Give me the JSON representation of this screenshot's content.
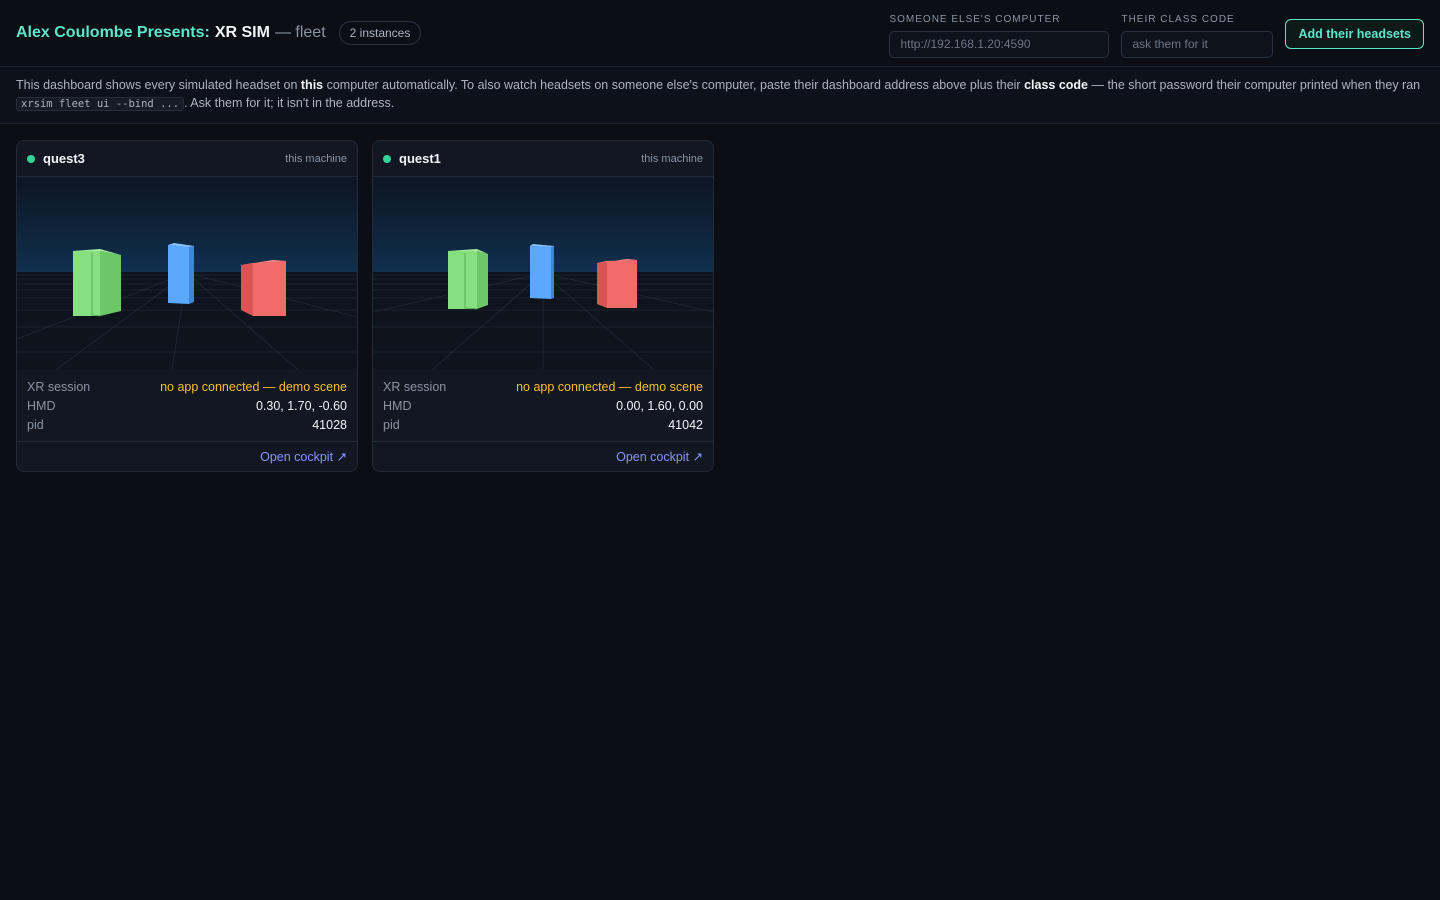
{
  "header": {
    "brand": "Alex Coulombe Presents:",
    "product": "XR SIM",
    "section": "— fleet",
    "instance_count": "2 instances"
  },
  "controls": {
    "address_label": "SOMEONE ELSE'S COMPUTER",
    "address_placeholder": "http://192.168.1.20:4590",
    "code_label": "THEIR CLASS CODE",
    "code_placeholder": "ask them for it",
    "add_button": "Add their headsets"
  },
  "info": {
    "t1": "This dashboard shows every simulated headset on ",
    "b1": "this",
    "t2": " computer automatically. To also watch headsets on someone else's computer, paste their dashboard address above plus their ",
    "b2": "class code",
    "t3": " — the short password their computer printed when they ran ",
    "code": "xrsim fleet ui --bind ...",
    "t4": ". Ask them for it; it isn't in the address."
  },
  "colors": {
    "accent": "#5ee6c8",
    "status_online": "#34d399",
    "warning": "#f5c02b",
    "link": "#8b93ff",
    "cube_green": "#86e07f",
    "cube_blue": "#5aa8ff",
    "cube_red": "#f26b6b"
  },
  "instances": [
    {
      "name": "quest3",
      "origin": "this machine",
      "status": "online",
      "session_label": "XR session",
      "session_value": "no app connected — demo scene",
      "hmd_label": "HMD",
      "hmd_value": "0.30, 1.70, -0.60",
      "pid_label": "pid",
      "pid_value": "41028",
      "link": "Open cockpit ↗"
    },
    {
      "name": "quest1",
      "origin": "this machine",
      "status": "online",
      "session_label": "XR session",
      "session_value": "no app connected — demo scene",
      "hmd_label": "HMD",
      "hmd_value": "0.00, 1.60, 0.00",
      "pid_label": "pid",
      "pid_value": "41042",
      "link": "Open cockpit ↗"
    }
  ]
}
